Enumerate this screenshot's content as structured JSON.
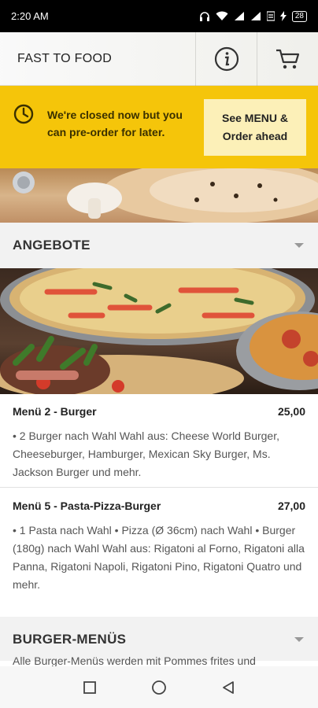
{
  "status_bar": {
    "time": "2:20 AM",
    "icons": [
      "headphones-icon",
      "wifi-icon",
      "signal-icon",
      "signal-icon",
      "data-icon",
      "charging-icon",
      "battery-icon"
    ],
    "battery": "28"
  },
  "app_bar": {
    "title": "FAST TO FOOD",
    "actions": [
      "info-icon",
      "cart-icon"
    ]
  },
  "banner": {
    "message": "We're closed now but you can pre-order for later.",
    "button_label": "See MENU & Order ahead",
    "color": "#f5c50a",
    "button_color": "#fcf0b8"
  },
  "sections": [
    {
      "title": "ANGEBOTE",
      "items": [
        {
          "name": "Menü 2 - Burger",
          "price": "25,00",
          "description": "• 2 Burger nach Wahl Wahl aus: Cheese World Burger, Cheeseburger, Hamburger, Mexican Sky Burger, Ms. Jackson Burger und mehr."
        },
        {
          "name": "Menü 5 - Pasta-Pizza-Burger",
          "price": "27,00",
          "description": "• 1 Pasta nach Wahl • Pizza (Ø 36cm) nach Wahl • Burger (180g) nach Wahl Wahl aus: Rigatoni al Forno, Rigatoni alla Panna, Rigatoni Napoli, Rigatoni Pino, Rigatoni Quatro und mehr."
        }
      ]
    },
    {
      "title": "BURGER-MENÜS",
      "description": "Alle Burger-Menüs werden mit Pommes frites und"
    }
  ],
  "nav_bar": [
    "recents-square-icon",
    "home-circle-icon",
    "back-triangle-icon"
  ]
}
